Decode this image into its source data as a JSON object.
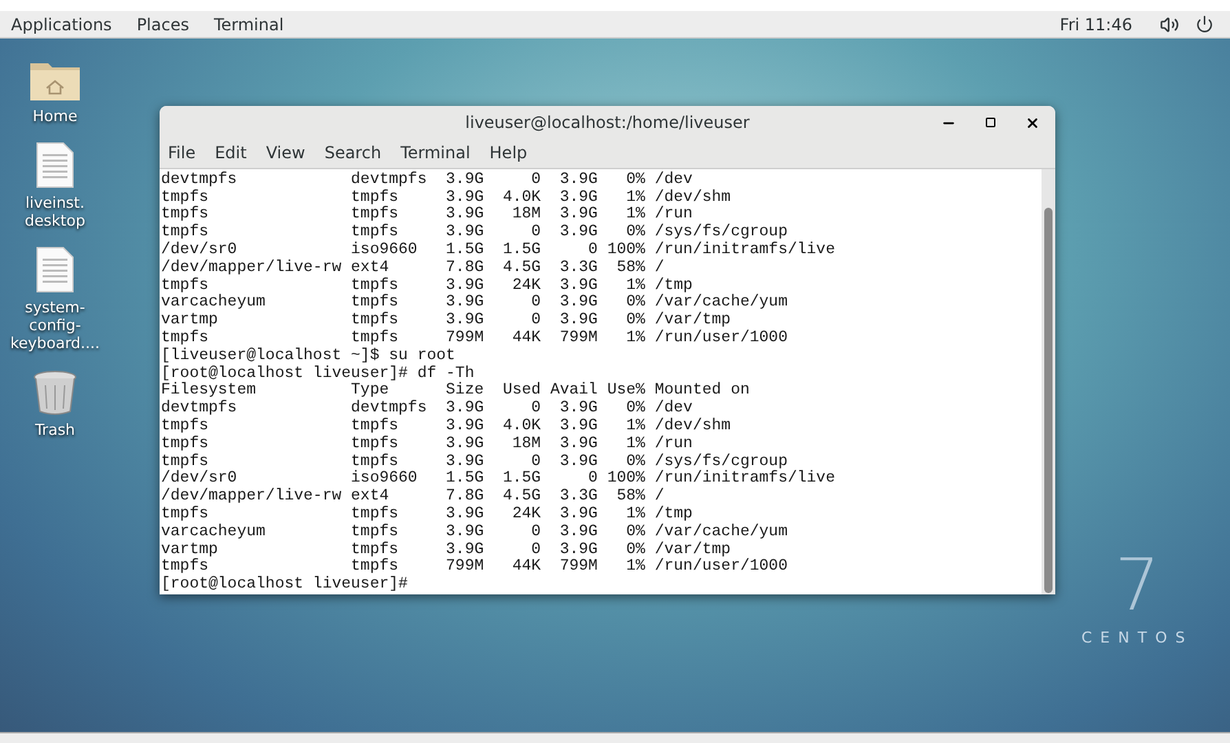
{
  "top_panel": {
    "menus": [
      "Applications",
      "Places",
      "Terminal"
    ],
    "clock": "Fri 11:46"
  },
  "desktop_icons": [
    {
      "kind": "folder",
      "label_lines": [
        "Home"
      ]
    },
    {
      "kind": "file",
      "label_lines": [
        "liveinst.",
        "desktop"
      ]
    },
    {
      "kind": "file",
      "label_lines": [
        "system-",
        "config-",
        "keyboard...."
      ]
    },
    {
      "kind": "trash",
      "label_lines": [
        "Trash"
      ]
    }
  ],
  "terminal": {
    "title": "liveuser@localhost:/home/liveuser",
    "menu": [
      "File",
      "Edit",
      "View",
      "Search",
      "Terminal",
      "Help"
    ],
    "lines": [
      "devtmpfs            devtmpfs  3.9G     0  3.9G   0% /dev",
      "tmpfs               tmpfs     3.9G  4.0K  3.9G   1% /dev/shm",
      "tmpfs               tmpfs     3.9G   18M  3.9G   1% /run",
      "tmpfs               tmpfs     3.9G     0  3.9G   0% /sys/fs/cgroup",
      "/dev/sr0            iso9660   1.5G  1.5G     0 100% /run/initramfs/live",
      "/dev/mapper/live-rw ext4      7.8G  4.5G  3.3G  58% /",
      "tmpfs               tmpfs     3.9G   24K  3.9G   1% /tmp",
      "varcacheyum         tmpfs     3.9G     0  3.9G   0% /var/cache/yum",
      "vartmp              tmpfs     3.9G     0  3.9G   0% /var/tmp",
      "tmpfs               tmpfs     799M   44K  799M   1% /run/user/1000",
      "[liveuser@localhost ~]$ su root",
      "[root@localhost liveuser]# df -Th",
      "Filesystem          Type      Size  Used Avail Use% Mounted on",
      "devtmpfs            devtmpfs  3.9G     0  3.9G   0% /dev",
      "tmpfs               tmpfs     3.9G  4.0K  3.9G   1% /dev/shm",
      "tmpfs               tmpfs     3.9G   18M  3.9G   1% /run",
      "tmpfs               tmpfs     3.9G     0  3.9G   0% /sys/fs/cgroup",
      "/dev/sr0            iso9660   1.5G  1.5G     0 100% /run/initramfs/live",
      "/dev/mapper/live-rw ext4      7.8G  4.5G  3.3G  58% /",
      "tmpfs               tmpfs     3.9G   24K  3.9G   1% /tmp",
      "varcacheyum         tmpfs     3.9G     0  3.9G   0% /var/cache/yum",
      "vartmp              tmpfs     3.9G     0  3.9G   0% /var/tmp",
      "tmpfs               tmpfs     799M   44K  799M   1% /run/user/1000",
      "[root@localhost liveuser]#"
    ]
  },
  "wallpaper_logo": {
    "numeral": "7",
    "word": "CENTOS"
  }
}
